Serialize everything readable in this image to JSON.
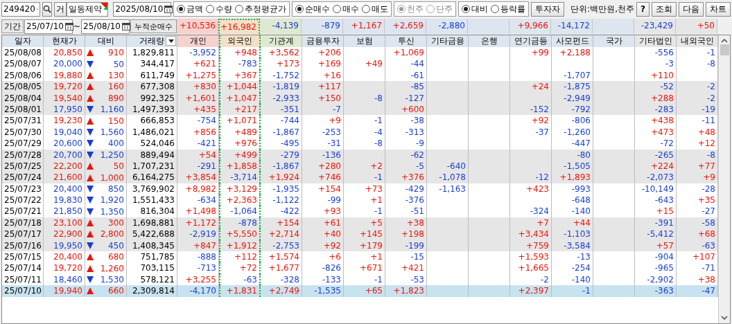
{
  "toolbar": {
    "stock_code": "249420",
    "search_tag": "거",
    "stock_name": "일동제약",
    "date": "2025/08/10",
    "radio_groups": [
      {
        "options": [
          {
            "label": "금액",
            "selected": true,
            "disabled": false
          },
          {
            "label": "수량",
            "selected": false,
            "disabled": false
          },
          {
            "label": "추정평균가",
            "selected": false,
            "disabled": false
          }
        ]
      },
      {
        "options": [
          {
            "label": "순매수",
            "selected": true,
            "disabled": false
          },
          {
            "label": "매수",
            "selected": false,
            "disabled": false
          },
          {
            "label": "매도",
            "selected": false,
            "disabled": false
          }
        ]
      },
      {
        "options": [
          {
            "label": "천주",
            "selected": true,
            "disabled": true
          },
          {
            "label": "단주",
            "selected": false,
            "disabled": true
          }
        ]
      },
      {
        "options": [
          {
            "label": "대비",
            "selected": true,
            "disabled": false
          },
          {
            "label": "등락률",
            "selected": false,
            "disabled": false
          }
        ]
      }
    ],
    "investor_button": "투자자",
    "unit_label": "단위:백만원,천주",
    "buttons": [
      "?",
      "조회",
      "다음",
      "차트"
    ]
  },
  "period": {
    "label": "기간",
    "from": "25/07/10",
    "separator": "~",
    "to": "25/08/10",
    "summary_label": "누적순매수",
    "summary": [
      {
        "kind": "value",
        "text": "+10,536"
      },
      {
        "kind": "value",
        "text": "+16,982"
      },
      {
        "kind": "value",
        "text": "-4,139"
      },
      {
        "kind": "value",
        "text": "-879"
      },
      {
        "kind": "value",
        "text": "+1,167"
      },
      {
        "kind": "value",
        "text": "+2,659"
      },
      {
        "kind": "value",
        "text": "-2,880"
      },
      {
        "kind": "blank"
      },
      {
        "kind": "value",
        "text": "+9,966"
      },
      {
        "kind": "value",
        "text": "-14,172"
      },
      {
        "kind": "blank"
      },
      {
        "kind": "value",
        "text": "-23,429"
      },
      {
        "kind": "value",
        "text": "+50"
      }
    ]
  },
  "table": {
    "columns": [
      {
        "label": "일자",
        "color": "#dde5ef",
        "selected": false,
        "kind": "plain"
      },
      {
        "label": "현재가",
        "color": "#dde5ef",
        "selected": false,
        "kind": "plain"
      },
      {
        "label": "대비",
        "color": "#dde5ef",
        "selected": false,
        "kind": "plain"
      },
      {
        "label": "거래량",
        "color": "#dde5ef",
        "selected": false,
        "kind": "dropdown"
      },
      {
        "label": "개인",
        "color": "#f6d2ce",
        "selected": false,
        "kind": "plain"
      },
      {
        "label": "외국인",
        "color": "#f3e0c6",
        "selected": true,
        "kind": "plain"
      },
      {
        "label": "기관계",
        "color": "#dfe9d1",
        "selected": false,
        "kind": "plain"
      },
      {
        "label": "금융투자",
        "color": "#dde5ef",
        "selected": false,
        "kind": "plain"
      },
      {
        "label": "보험",
        "color": "#dde5ef",
        "selected": false,
        "kind": "plain"
      },
      {
        "label": "투신",
        "color": "#dde5ef",
        "selected": false,
        "kind": "plain"
      },
      {
        "label": "기타금융",
        "color": "#dde5ef",
        "selected": false,
        "kind": "plain"
      },
      {
        "label": "은행",
        "color": "#dde5ef",
        "selected": false,
        "kind": "plain"
      },
      {
        "label": "연기금등",
        "color": "#dde5ef",
        "selected": false,
        "kind": "plain"
      },
      {
        "label": "사모펀드",
        "color": "#dde5ef",
        "selected": false,
        "kind": "plain"
      },
      {
        "label": "국가",
        "color": "#dde5ef",
        "selected": false,
        "kind": "plain"
      },
      {
        "label": "기타법인",
        "color": "#e6e6e6",
        "selected": false,
        "kind": "plain"
      },
      {
        "label": "내외국인",
        "color": "#e6e6e6",
        "selected": false,
        "kind": "plain"
      }
    ],
    "rows": [
      {
        "date": "25/08/08",
        "price": "20,850",
        "up": true,
        "change": "910",
        "volume": "1,829,811",
        "values": [
          {
            "kind": "value",
            "text": "-3,952"
          },
          {
            "kind": "value",
            "text": "+948"
          },
          {
            "kind": "value",
            "text": "+3,562"
          },
          {
            "kind": "value",
            "text": "+206"
          },
          {
            "kind": "blank"
          },
          {
            "kind": "value",
            "text": "+1,069"
          },
          {
            "kind": "blank"
          },
          {
            "kind": "blank"
          },
          {
            "kind": "value",
            "text": "+99"
          },
          {
            "kind": "value",
            "text": "+2,188"
          },
          {
            "kind": "blank"
          },
          {
            "kind": "value",
            "text": "-556"
          },
          {
            "kind": "value",
            "text": "-1"
          }
        ],
        "selected": false
      },
      {
        "date": "25/08/07",
        "price": "20,000",
        "up": false,
        "change": "50",
        "volume": "344,417",
        "values": [
          {
            "kind": "value",
            "text": "+621"
          },
          {
            "kind": "value",
            "text": "-783"
          },
          {
            "kind": "value",
            "text": "+173"
          },
          {
            "kind": "value",
            "text": "+169"
          },
          {
            "kind": "value",
            "text": "+49"
          },
          {
            "kind": "value",
            "text": "-44"
          },
          {
            "kind": "blank"
          },
          {
            "kind": "blank"
          },
          {
            "kind": "blank"
          },
          {
            "kind": "blank"
          },
          {
            "kind": "blank"
          },
          {
            "kind": "value",
            "text": "-3"
          },
          {
            "kind": "value",
            "text": "-8"
          }
        ],
        "selected": false
      },
      {
        "date": "25/08/06",
        "price": "19,880",
        "up": true,
        "change": "130",
        "volume": "611,749",
        "values": [
          {
            "kind": "value",
            "text": "+1,275"
          },
          {
            "kind": "value",
            "text": "+367"
          },
          {
            "kind": "value",
            "text": "-1,752"
          },
          {
            "kind": "value",
            "text": "+16"
          },
          {
            "kind": "blank"
          },
          {
            "kind": "value",
            "text": "-61"
          },
          {
            "kind": "blank"
          },
          {
            "kind": "blank"
          },
          {
            "kind": "blank"
          },
          {
            "kind": "value",
            "text": "-1,707"
          },
          {
            "kind": "blank"
          },
          {
            "kind": "value",
            "text": "+110"
          },
          {
            "kind": "blank"
          }
        ],
        "selected": false
      },
      {
        "date": "25/08/05",
        "price": "19,720",
        "up": true,
        "change": "160",
        "volume": "677,308",
        "values": [
          {
            "kind": "value",
            "text": "+830"
          },
          {
            "kind": "value",
            "text": "+1,044"
          },
          {
            "kind": "value",
            "text": "-1,819"
          },
          {
            "kind": "value",
            "text": "+117"
          },
          {
            "kind": "blank"
          },
          {
            "kind": "value",
            "text": "-85"
          },
          {
            "kind": "blank"
          },
          {
            "kind": "blank"
          },
          {
            "kind": "value",
            "text": "+24"
          },
          {
            "kind": "value",
            "text": "-1,875"
          },
          {
            "kind": "blank"
          },
          {
            "kind": "value",
            "text": "-52"
          },
          {
            "kind": "value",
            "text": "-2"
          }
        ],
        "selected": false
      },
      {
        "date": "25/08/04",
        "price": "19,540",
        "up": true,
        "change": "890",
        "volume": "992,325",
        "values": [
          {
            "kind": "value",
            "text": "+1,601"
          },
          {
            "kind": "value",
            "text": "+1,047"
          },
          {
            "kind": "value",
            "text": "-2,933"
          },
          {
            "kind": "value",
            "text": "+150"
          },
          {
            "kind": "value",
            "text": "-8"
          },
          {
            "kind": "value",
            "text": "-127"
          },
          {
            "kind": "blank"
          },
          {
            "kind": "blank"
          },
          {
            "kind": "blank"
          },
          {
            "kind": "value",
            "text": "-2,949"
          },
          {
            "kind": "blank"
          },
          {
            "kind": "value",
            "text": "+288"
          },
          {
            "kind": "value",
            "text": "-2"
          }
        ],
        "selected": false
      },
      {
        "date": "25/08/01",
        "price": "17,950",
        "up": false,
        "change": "1,160",
        "volume": "1,497,393",
        "values": [
          {
            "kind": "value",
            "text": "+435"
          },
          {
            "kind": "value",
            "text": "+217"
          },
          {
            "kind": "value",
            "text": "-351"
          },
          {
            "kind": "value",
            "text": "-7"
          },
          {
            "kind": "blank"
          },
          {
            "kind": "value",
            "text": "+600"
          },
          {
            "kind": "blank"
          },
          {
            "kind": "blank"
          },
          {
            "kind": "value",
            "text": "-152"
          },
          {
            "kind": "value",
            "text": "-792"
          },
          {
            "kind": "blank"
          },
          {
            "kind": "value",
            "text": "-283"
          },
          {
            "kind": "value",
            "text": "-19"
          }
        ],
        "selected": false
      },
      {
        "date": "25/07/31",
        "price": "19,230",
        "up": true,
        "change": "150",
        "volume": "666,853",
        "values": [
          {
            "kind": "value",
            "text": "-754"
          },
          {
            "kind": "value",
            "text": "+1,071"
          },
          {
            "kind": "value",
            "text": "-744"
          },
          {
            "kind": "value",
            "text": "+9"
          },
          {
            "kind": "value",
            "text": "-1"
          },
          {
            "kind": "value",
            "text": "-38"
          },
          {
            "kind": "blank"
          },
          {
            "kind": "blank"
          },
          {
            "kind": "value",
            "text": "+92"
          },
          {
            "kind": "value",
            "text": "-806"
          },
          {
            "kind": "blank"
          },
          {
            "kind": "value",
            "text": "+438"
          },
          {
            "kind": "value",
            "text": "-11"
          }
        ],
        "selected": false
      },
      {
        "date": "25/07/30",
        "price": "19,040",
        "up": false,
        "change": "1,560",
        "volume": "1,486,021",
        "values": [
          {
            "kind": "value",
            "text": "+856"
          },
          {
            "kind": "value",
            "text": "+489"
          },
          {
            "kind": "value",
            "text": "-1,867"
          },
          {
            "kind": "value",
            "text": "-253"
          },
          {
            "kind": "value",
            "text": "-4"
          },
          {
            "kind": "value",
            "text": "-313"
          },
          {
            "kind": "blank"
          },
          {
            "kind": "blank"
          },
          {
            "kind": "value",
            "text": "-37"
          },
          {
            "kind": "value",
            "text": "-1,260"
          },
          {
            "kind": "blank"
          },
          {
            "kind": "value",
            "text": "+473"
          },
          {
            "kind": "value",
            "text": "+48"
          }
        ],
        "selected": false
      },
      {
        "date": "25/07/29",
        "price": "20,600",
        "up": false,
        "change": "400",
        "volume": "524,046",
        "values": [
          {
            "kind": "value",
            "text": "-421"
          },
          {
            "kind": "value",
            "text": "+976"
          },
          {
            "kind": "value",
            "text": "-495"
          },
          {
            "kind": "value",
            "text": "-31"
          },
          {
            "kind": "value",
            "text": "-8"
          },
          {
            "kind": "value",
            "text": "-9"
          },
          {
            "kind": "blank"
          },
          {
            "kind": "blank"
          },
          {
            "kind": "blank"
          },
          {
            "kind": "value",
            "text": "-447"
          },
          {
            "kind": "blank"
          },
          {
            "kind": "value",
            "text": "-72"
          },
          {
            "kind": "value",
            "text": "+12"
          }
        ],
        "selected": false
      },
      {
        "date": "25/07/28",
        "price": "20,700",
        "up": false,
        "change": "1,250",
        "volume": "889,494",
        "values": [
          {
            "kind": "value",
            "text": "+54"
          },
          {
            "kind": "value",
            "text": "+499"
          },
          {
            "kind": "value",
            "text": "-279"
          },
          {
            "kind": "value",
            "text": "-136"
          },
          {
            "kind": "blank"
          },
          {
            "kind": "value",
            "text": "-62"
          },
          {
            "kind": "blank"
          },
          {
            "kind": "blank"
          },
          {
            "kind": "blank"
          },
          {
            "kind": "value",
            "text": "-80"
          },
          {
            "kind": "blank"
          },
          {
            "kind": "value",
            "text": "-265"
          },
          {
            "kind": "value",
            "text": "-8"
          }
        ],
        "selected": false
      },
      {
        "date": "25/07/25",
        "price": "22,200",
        "up": true,
        "change": "50",
        "volume": "1,707,231",
        "values": [
          {
            "kind": "value",
            "text": "-291"
          },
          {
            "kind": "value",
            "text": "+1,858"
          },
          {
            "kind": "value",
            "text": "-1,867"
          },
          {
            "kind": "value",
            "text": "+280"
          },
          {
            "kind": "value",
            "text": "+2"
          },
          {
            "kind": "value",
            "text": "-5"
          },
          {
            "kind": "value",
            "text": "-640"
          },
          {
            "kind": "blank"
          },
          {
            "kind": "blank"
          },
          {
            "kind": "value",
            "text": "-1,505"
          },
          {
            "kind": "blank"
          },
          {
            "kind": "value",
            "text": "+224"
          },
          {
            "kind": "value",
            "text": "+77"
          }
        ],
        "selected": false
      },
      {
        "date": "25/07/24",
        "price": "21,600",
        "up": true,
        "change": "1,000",
        "volume": "6,164,275",
        "values": [
          {
            "kind": "value",
            "text": "+3,854"
          },
          {
            "kind": "value",
            "text": "-3,714"
          },
          {
            "kind": "value",
            "text": "+1,924"
          },
          {
            "kind": "value",
            "text": "+746"
          },
          {
            "kind": "value",
            "text": "-1"
          },
          {
            "kind": "value",
            "text": "+376"
          },
          {
            "kind": "value",
            "text": "-1,078"
          },
          {
            "kind": "blank"
          },
          {
            "kind": "value",
            "text": "-12"
          },
          {
            "kind": "value",
            "text": "+1,893"
          },
          {
            "kind": "blank"
          },
          {
            "kind": "value",
            "text": "-2,073"
          },
          {
            "kind": "value",
            "text": "+9"
          }
        ],
        "selected": false
      },
      {
        "date": "25/07/23",
        "price": "20,400",
        "up": false,
        "change": "850",
        "volume": "3,769,902",
        "values": [
          {
            "kind": "value",
            "text": "+8,982"
          },
          {
            "kind": "value",
            "text": "+3,129"
          },
          {
            "kind": "value",
            "text": "-1,935"
          },
          {
            "kind": "value",
            "text": "+154"
          },
          {
            "kind": "value",
            "text": "+73"
          },
          {
            "kind": "value",
            "text": "-429"
          },
          {
            "kind": "value",
            "text": "-1,163"
          },
          {
            "kind": "blank"
          },
          {
            "kind": "value",
            "text": "+423"
          },
          {
            "kind": "value",
            "text": "-993"
          },
          {
            "kind": "blank"
          },
          {
            "kind": "value",
            "text": "-10,149"
          },
          {
            "kind": "value",
            "text": "-28"
          }
        ],
        "selected": false
      },
      {
        "date": "25/07/22",
        "price": "19,830",
        "up": false,
        "change": "1,920",
        "volume": "1,551,433",
        "values": [
          {
            "kind": "value",
            "text": "-634"
          },
          {
            "kind": "value",
            "text": "+2,363"
          },
          {
            "kind": "value",
            "text": "-1,122"
          },
          {
            "kind": "value",
            "text": "-99"
          },
          {
            "kind": "value",
            "text": "+1"
          },
          {
            "kind": "value",
            "text": "-376"
          },
          {
            "kind": "blank"
          },
          {
            "kind": "blank"
          },
          {
            "kind": "blank"
          },
          {
            "kind": "value",
            "text": "-648"
          },
          {
            "kind": "blank"
          },
          {
            "kind": "value",
            "text": "-643"
          },
          {
            "kind": "value",
            "text": "+35"
          }
        ],
        "selected": false
      },
      {
        "date": "25/07/21",
        "price": "21,850",
        "up": false,
        "change": "1,350",
        "volume": "816,304",
        "values": [
          {
            "kind": "value",
            "text": "+1,498"
          },
          {
            "kind": "value",
            "text": "-1,064"
          },
          {
            "kind": "value",
            "text": "-422"
          },
          {
            "kind": "value",
            "text": "+93"
          },
          {
            "kind": "value",
            "text": "-1"
          },
          {
            "kind": "value",
            "text": "-51"
          },
          {
            "kind": "blank"
          },
          {
            "kind": "blank"
          },
          {
            "kind": "value",
            "text": "-324"
          },
          {
            "kind": "value",
            "text": "-140"
          },
          {
            "kind": "blank"
          },
          {
            "kind": "value",
            "text": "+15"
          },
          {
            "kind": "value",
            "text": "-27"
          }
        ],
        "selected": false
      },
      {
        "date": "25/07/18",
        "price": "23,100",
        "up": true,
        "change": "300",
        "volume": "1,698,881",
        "values": [
          {
            "kind": "value",
            "text": "+1,172"
          },
          {
            "kind": "value",
            "text": "-878"
          },
          {
            "kind": "value",
            "text": "+154"
          },
          {
            "kind": "value",
            "text": "+61"
          },
          {
            "kind": "value",
            "text": "+5"
          },
          {
            "kind": "value",
            "text": "+38"
          },
          {
            "kind": "blank"
          },
          {
            "kind": "blank"
          },
          {
            "kind": "value",
            "text": "+7"
          },
          {
            "kind": "value",
            "text": "+44"
          },
          {
            "kind": "blank"
          },
          {
            "kind": "value",
            "text": "-391"
          },
          {
            "kind": "value",
            "text": "-58"
          }
        ],
        "selected": false
      },
      {
        "date": "25/07/17",
        "price": "22,900",
        "up": true,
        "change": "2,800",
        "volume": "5,422,688",
        "values": [
          {
            "kind": "value",
            "text": "-2,919"
          },
          {
            "kind": "value",
            "text": "+5,550"
          },
          {
            "kind": "value",
            "text": "+2,714"
          },
          {
            "kind": "value",
            "text": "+40"
          },
          {
            "kind": "value",
            "text": "+145"
          },
          {
            "kind": "value",
            "text": "+198"
          },
          {
            "kind": "blank"
          },
          {
            "kind": "blank"
          },
          {
            "kind": "value",
            "text": "+3,434"
          },
          {
            "kind": "value",
            "text": "-1,103"
          },
          {
            "kind": "blank"
          },
          {
            "kind": "value",
            "text": "-5,412"
          },
          {
            "kind": "value",
            "text": "+68"
          }
        ],
        "selected": false
      },
      {
        "date": "25/07/16",
        "price": "19,950",
        "up": false,
        "change": "450",
        "volume": "1,408,345",
        "values": [
          {
            "kind": "value",
            "text": "+847"
          },
          {
            "kind": "value",
            "text": "+1,912"
          },
          {
            "kind": "value",
            "text": "-2,753"
          },
          {
            "kind": "value",
            "text": "+92"
          },
          {
            "kind": "value",
            "text": "+179"
          },
          {
            "kind": "value",
            "text": "-199"
          },
          {
            "kind": "blank"
          },
          {
            "kind": "blank"
          },
          {
            "kind": "value",
            "text": "+759"
          },
          {
            "kind": "value",
            "text": "-3,584"
          },
          {
            "kind": "blank"
          },
          {
            "kind": "value",
            "text": "+57"
          },
          {
            "kind": "value",
            "text": "-63"
          }
        ],
        "selected": false
      },
      {
        "date": "25/07/15",
        "price": "20,400",
        "up": true,
        "change": "680",
        "volume": "751,785",
        "values": [
          {
            "kind": "value",
            "text": "-888"
          },
          {
            "kind": "value",
            "text": "+112"
          },
          {
            "kind": "value",
            "text": "+1,574"
          },
          {
            "kind": "value",
            "text": "+6"
          },
          {
            "kind": "value",
            "text": "+1"
          },
          {
            "kind": "value",
            "text": "-15"
          },
          {
            "kind": "blank"
          },
          {
            "kind": "blank"
          },
          {
            "kind": "value",
            "text": "+1,593"
          },
          {
            "kind": "value",
            "text": "-13"
          },
          {
            "kind": "blank"
          },
          {
            "kind": "value",
            "text": "-904"
          },
          {
            "kind": "value",
            "text": "+107"
          }
        ],
        "selected": false
      },
      {
        "date": "25/07/14",
        "price": "19,720",
        "up": true,
        "change": "1,260",
        "volume": "703,115",
        "values": [
          {
            "kind": "value",
            "text": "-713"
          },
          {
            "kind": "value",
            "text": "+72"
          },
          {
            "kind": "value",
            "text": "+1,677"
          },
          {
            "kind": "value",
            "text": "-826"
          },
          {
            "kind": "value",
            "text": "+671"
          },
          {
            "kind": "value",
            "text": "+421"
          },
          {
            "kind": "blank"
          },
          {
            "kind": "blank"
          },
          {
            "kind": "value",
            "text": "+1,665"
          },
          {
            "kind": "value",
            "text": "-254"
          },
          {
            "kind": "blank"
          },
          {
            "kind": "value",
            "text": "-965"
          },
          {
            "kind": "value",
            "text": "-71"
          }
        ],
        "selected": false
      },
      {
        "date": "25/07/11",
        "price": "18,460",
        "up": false,
        "change": "1,530",
        "volume": "578,121",
        "values": [
          {
            "kind": "value",
            "text": "+3,255"
          },
          {
            "kind": "value",
            "text": "-63"
          },
          {
            "kind": "value",
            "text": "-328"
          },
          {
            "kind": "value",
            "text": "-133"
          },
          {
            "kind": "value",
            "text": "-1"
          },
          {
            "kind": "value",
            "text": "-53"
          },
          {
            "kind": "blank"
          },
          {
            "kind": "blank"
          },
          {
            "kind": "value",
            "text": "-2"
          },
          {
            "kind": "value",
            "text": "-140"
          },
          {
            "kind": "blank"
          },
          {
            "kind": "value",
            "text": "-2,902"
          },
          {
            "kind": "value",
            "text": "+38"
          }
        ],
        "selected": false
      },
      {
        "date": "25/07/10",
        "price": "19,940",
        "up": true,
        "change": "660",
        "volume": "2,309,814",
        "values": [
          {
            "kind": "value",
            "text": "-4,170"
          },
          {
            "kind": "value",
            "text": "+1,831"
          },
          {
            "kind": "value",
            "text": "+2,749"
          },
          {
            "kind": "value",
            "text": "-1,535"
          },
          {
            "kind": "value",
            "text": "+65"
          },
          {
            "kind": "value",
            "text": "+1,823"
          },
          {
            "kind": "blank"
          },
          {
            "kind": "blank"
          },
          {
            "kind": "value",
            "text": "+2,397"
          },
          {
            "kind": "value",
            "text": "-1"
          },
          {
            "kind": "blank"
          },
          {
            "kind": "value",
            "text": "-363"
          },
          {
            "kind": "value",
            "text": "-47"
          }
        ],
        "selected": true
      }
    ]
  }
}
